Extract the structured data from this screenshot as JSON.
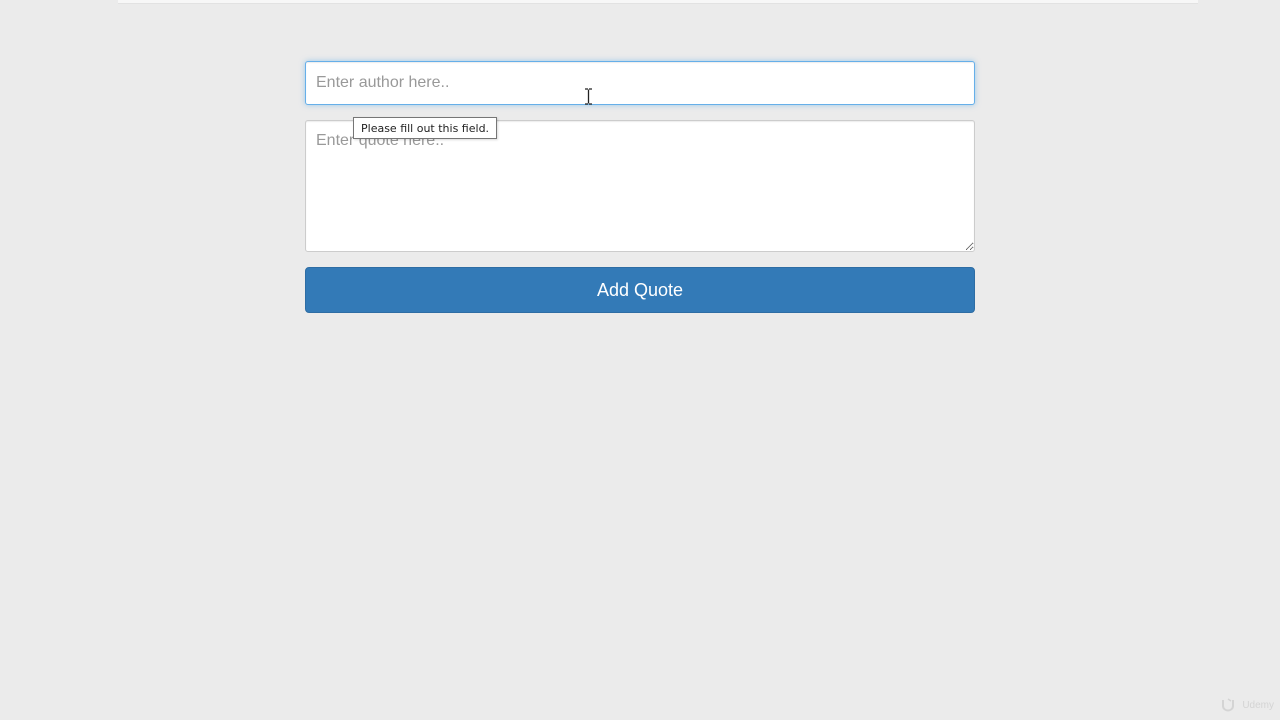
{
  "form": {
    "author_placeholder": "Enter author here..",
    "quote_placeholder": "Enter quote here..",
    "submit_label": "Add Quote"
  },
  "validation": {
    "tooltip": "Please fill out this field."
  },
  "cursor": {
    "icon": "text-cursor-icon"
  },
  "watermark": {
    "text": "Udemy",
    "icon": "udemy-logo-icon"
  },
  "colors": {
    "background": "#ebebeb",
    "button": "#337ab7",
    "focus_border": "#66afe9"
  }
}
